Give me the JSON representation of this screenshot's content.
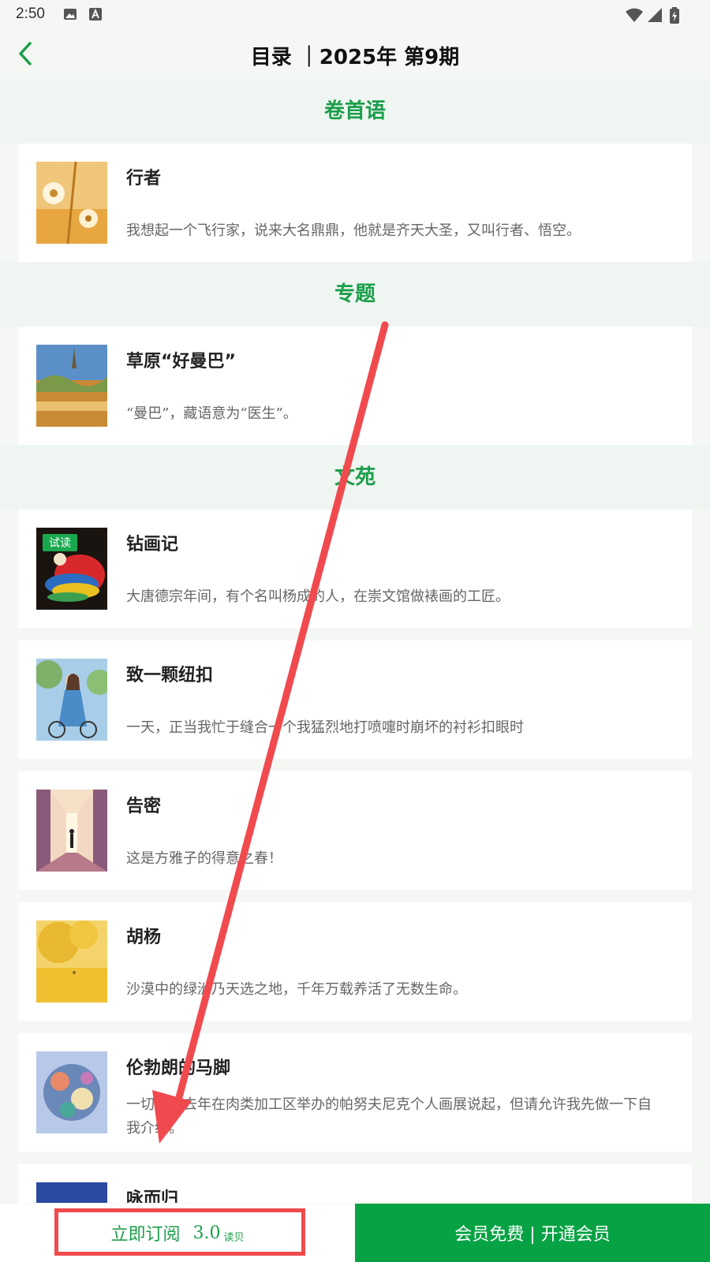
{
  "status_bar": {
    "time": "2:50"
  },
  "header": {
    "title": "目录 ｜2025年 第9期"
  },
  "sections": [
    {
      "title": "卷首语",
      "items": [
        {
          "title": "行者",
          "desc": "我想起一个飞行家，说来大名鼎鼎，他就是齐天大圣，又叫行者、悟空。"
        }
      ]
    },
    {
      "title": "专题",
      "items": [
        {
          "title": "草原“好曼巴”",
          "desc": "“曼巴”，藏语意为“医生”。"
        }
      ]
    },
    {
      "title": "文苑",
      "items": [
        {
          "title": "钻画记",
          "desc": "大唐德宗年间，有个名叫杨成的人，在崇文馆做裱画的工匠。",
          "badge": "试读"
        },
        {
          "title": "致一颗纽扣",
          "desc": "一天，正当我忙于缝合一个我猛烈地打喷嚏时崩坏的衬衫扣眼时"
        },
        {
          "title": "告密",
          "desc": "这是方雅子的得意之春！"
        },
        {
          "title": "胡杨",
          "desc": "沙漠中的绿洲乃天选之地，千年万载养活了无数生命。"
        },
        {
          "title": "伦勃朗的马脚",
          "desc": "一切要从去年在肉类加工区举办的帕努夫尼克个人画展说起，但请允许我先做一下自我介绍。"
        },
        {
          "title": "咏而归",
          "desc": ""
        }
      ]
    }
  ],
  "bottom_bar": {
    "subscribe_label": "立即订阅",
    "subscribe_price": "3.0",
    "subscribe_unit": "读贝",
    "member_label": "会员免费 | 开通会员"
  },
  "colors": {
    "accent": "#1a9e4a",
    "member_bg": "#07a244",
    "annotation": "#f04a4f"
  }
}
